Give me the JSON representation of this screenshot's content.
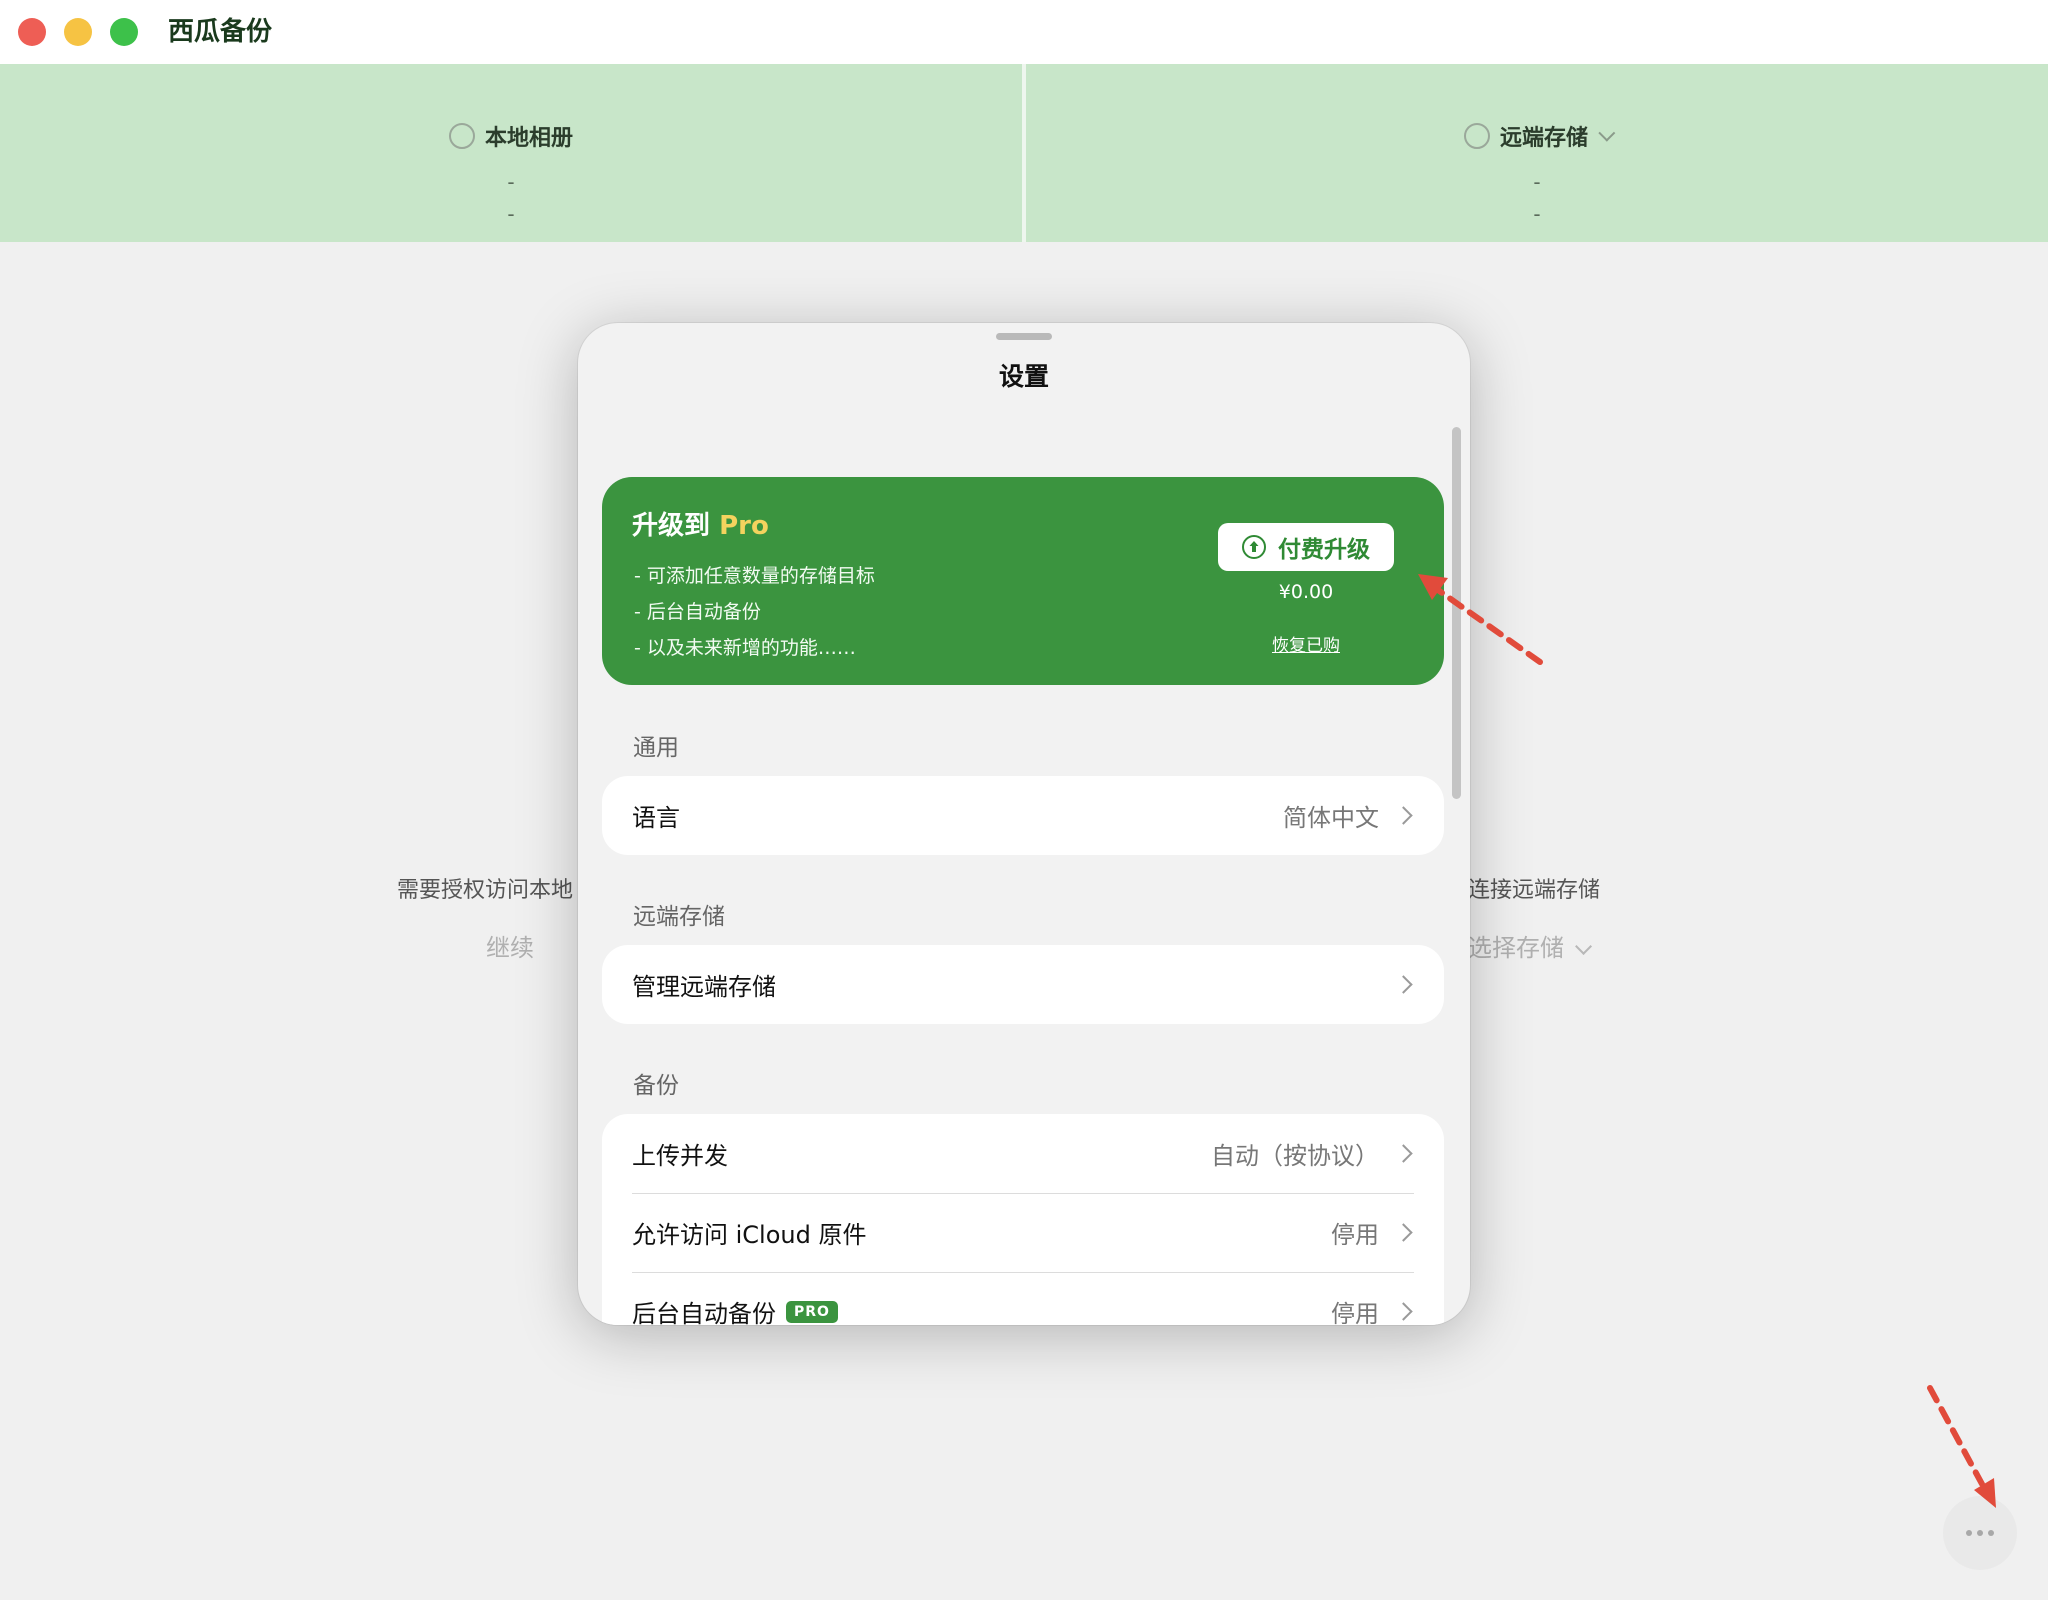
{
  "app": {
    "title": "西瓜备份"
  },
  "header": {
    "left": {
      "title": "本地相册",
      "line1": "-",
      "line2": "-"
    },
    "right": {
      "title": "远端存储",
      "line1": "-",
      "line2": "-"
    }
  },
  "background": {
    "left_message": "需要授权访问本地",
    "left_action": "继续",
    "right_message": "未连接远端存储",
    "right_action": "选择存储"
  },
  "settings": {
    "title": "设置",
    "pro_card": {
      "title_prefix": "升级到 ",
      "title_pro": "Pro",
      "features": [
        "- 可添加任意数量的存储目标",
        "- 后台自动备份",
        "- 以及未来新增的功能……"
      ],
      "upgrade_label": "付费升级",
      "price": "¥0.00",
      "restore_label": "恢复已购"
    },
    "sections": {
      "general": {
        "header": "通用",
        "rows": [
          {
            "label": "语言",
            "value": "简体中文"
          }
        ]
      },
      "remote": {
        "header": "远端存储",
        "rows": [
          {
            "label": "管理远端存储",
            "value": ""
          }
        ]
      },
      "backup": {
        "header": "备份",
        "rows": [
          {
            "label": "上传并发",
            "value": "自动（按协议）"
          },
          {
            "label": "允许访问 iCloud 原件",
            "value": "停用"
          },
          {
            "label": "后台自动备份",
            "badge": "PRO",
            "value": "停用"
          }
        ]
      }
    }
  },
  "colors": {
    "accent_green": "#3b943f",
    "header_green": "#c8e6c9",
    "pro_yellow": "#f4d35e",
    "annotation_red": "#e14b3b"
  },
  "icons": {
    "more": "ellipsis-icon",
    "upgrade": "arrow-up-circle-icon"
  }
}
